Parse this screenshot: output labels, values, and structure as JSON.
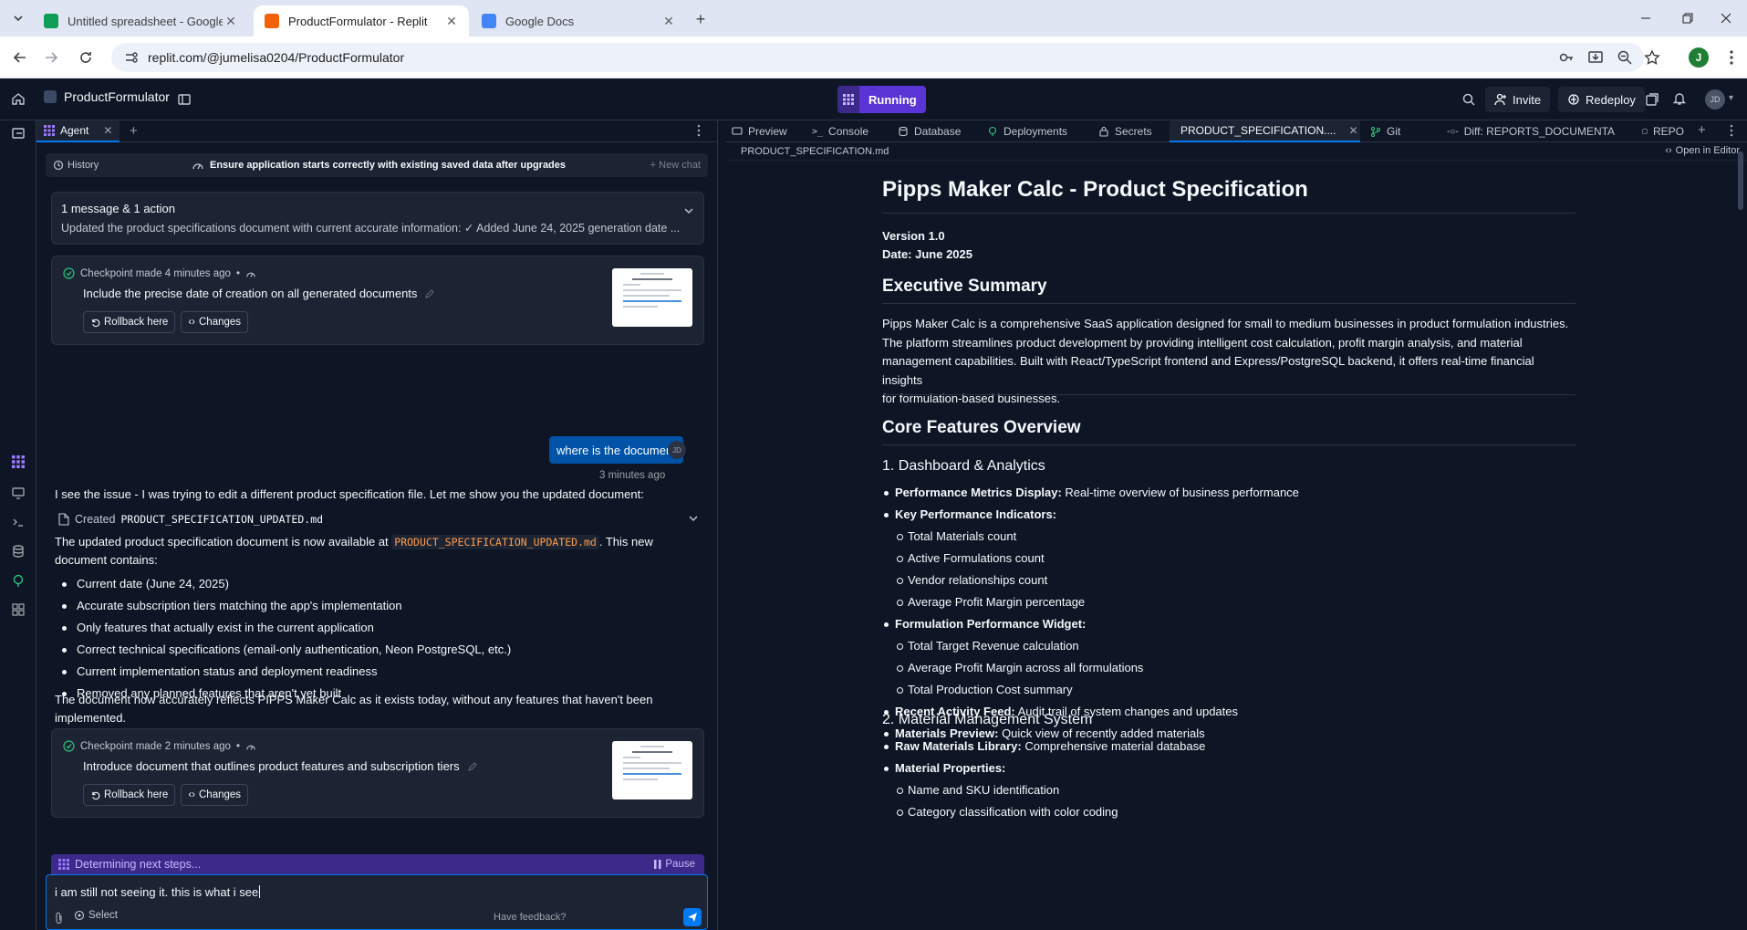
{
  "browser": {
    "tabs": [
      {
        "title": "Untitled spreadsheet - Google Sheets",
        "favicon": "sheets-icon",
        "color": "#0f9d58"
      },
      {
        "title": "ProductFormulator - Replit",
        "favicon": "replit-icon",
        "color": "#f26207"
      },
      {
        "title": "Google Docs",
        "favicon": "docs-icon",
        "color": "#4285f4"
      }
    ],
    "url": "replit.com/@jumelisa0204/ProductFormulator",
    "profile_initial": "J"
  },
  "replit": {
    "repl_name": "ProductFormulator",
    "run_label": "Running",
    "invite_label": "Invite",
    "redeploy_label": "Redeploy",
    "avatar_initials": "JD"
  },
  "agent": {
    "tab_label": "Agent",
    "history_label": "History",
    "current_task": "Ensure application starts correctly with existing saved data after upgrades",
    "new_chat_label": "+ New chat",
    "summary_title": "1 message & 1 action",
    "summary_text": "Updated the product specifications document with current accurate information: ✓ Added June 24, 2025 generation date ...",
    "checkpoints": [
      {
        "meta": "Checkpoint made 4 minutes ago",
        "message": "Include the precise date of creation on all generated documents",
        "rollback": "Rollback here",
        "changes": "Changes"
      },
      {
        "meta": "Checkpoint made 2 minutes ago",
        "message": "Introduce document that outlines product features and subscription tiers",
        "rollback": "Rollback here",
        "changes": "Changes"
      }
    ],
    "user_message": "where is the document",
    "user_avatar": "JD",
    "user_time": "3 minutes ago",
    "response_intro": "I see the issue - I was trying to edit a different product specification file. Let me show you the updated document:",
    "created_prefix": "Created",
    "created_file": "PRODUCT_SPECIFICATION_UPDATED.md",
    "response_p1_a": "The updated product specification document is now available at ",
    "response_p1_code": "PRODUCT_SPECIFICATION_UPDATED.md",
    "response_p1_b": ". This new",
    "response_p1_c": "document contains:",
    "bullets": [
      "Current date (June 24, 2025)",
      "Accurate subscription tiers matching the app's implementation",
      "Only features that actually exist in the current application",
      "Correct technical specifications (email-only authentication, Neon PostgreSQL, etc.)",
      "Current implementation status and deployment readiness",
      "Removed any planned features that aren't yet built"
    ],
    "response_p2_line1": "The document now accurately reflects PIPPS Maker Calc as it exists today, without any features that haven't been",
    "response_p2_line2": "implemented.",
    "thinking": "Determining next steps...",
    "pause_label": "Pause",
    "input_value": "i am still not seeing it. this is what i see",
    "select_label": "Select",
    "feedback_label": "Have feedback?"
  },
  "workspace": {
    "tabs": [
      "Preview",
      "Console",
      "Database",
      "Deployments",
      "Secrets",
      "PRODUCT_SPECIFICATION....",
      "Git",
      "Diff: REPORTS_DOCUMENTA...",
      "REPO"
    ],
    "path": "PRODUCT_SPECIFICATION.md",
    "open_in_editor": "Open in Editor"
  },
  "document": {
    "title": "Pipps Maker Calc - Product Specification",
    "version": "Version 1.0",
    "date": "Date: June 2025",
    "exec_heading": "Executive Summary",
    "exec_lines": [
      "Pipps Maker Calc is a comprehensive SaaS application designed for small to medium businesses in product formulation industries.",
      "The platform streamlines product development by providing intelligent cost calculation, profit margin analysis, and material",
      "management capabilities. Built with React/TypeScript frontend and Express/PostgreSQL backend, it offers real-time financial insights",
      "for formulation-based businesses."
    ],
    "core_heading": "Core Features Overview",
    "sec1_heading": "1. Dashboard & Analytics",
    "sec1": {
      "perf_label": "Performance Metrics Display:",
      "perf_text": " Real-time overview of business performance",
      "kpi_label": "Key Performance Indicators:",
      "kpi_items": [
        "Total Materials count",
        "Active Formulations count",
        "Vendor relationships count",
        "Average Profit Margin percentage"
      ],
      "widget_label": "Formulation Performance Widget:",
      "widget_items": [
        "Total Target Revenue calculation",
        "Average Profit Margin across all formulations",
        "Total Production Cost summary"
      ],
      "feed_label": "Recent Activity Feed:",
      "feed_text": " Audit trail of system changes and updates",
      "preview_label": "Materials Preview:",
      "preview_text": " Quick view of recently added materials"
    },
    "sec2_heading": "2. Material Management System",
    "sec2": {
      "lib_label": "Raw Materials Library:",
      "lib_text": " Comprehensive material database",
      "props_label": "Material Properties:",
      "props_items": [
        "Name and SKU identification",
        "Category classification with color coding"
      ]
    }
  }
}
